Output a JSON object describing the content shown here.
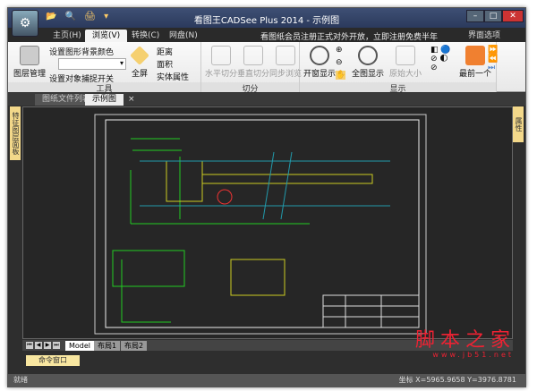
{
  "window": {
    "title": "看图王CADSee Plus 2014 - 示例图",
    "quick_access": "📂 🔍 🖨 ▾",
    "minimize": "–",
    "maximize": "□",
    "close": "✕"
  },
  "ribbon_tabs": [
    {
      "label": "主页(H)"
    },
    {
      "label": "浏览(V)"
    },
    {
      "label": "转换(C)"
    },
    {
      "label": "网盘(N)"
    }
  ],
  "notice": "看图纸会员注册正式对外开放，立即注册免费半年",
  "ui_options": "界面选项",
  "groups": {
    "tools": {
      "label": "工具",
      "layer_manager": "图层管理",
      "set_bg": "设置图形背景颜色",
      "snap": "设置对象捕捉开关",
      "fullscreen": "全屏",
      "distance": "距离",
      "area": "面积",
      "entity_props": "实体属性"
    },
    "split": {
      "label": "切分",
      "horizontal": "水平切分",
      "vertical": "垂直切分",
      "sync": "同步浏览"
    },
    "display": {
      "label": "显示",
      "window_zoom": "开窗显示",
      "full_display": "全图显示",
      "original_size": "原始大小",
      "last_one": "最前一个"
    }
  },
  "doc_tabs": [
    {
      "label": "图纸文件列表"
    },
    {
      "label": "示例图"
    }
  ],
  "left_panel": "特征图层面板",
  "right_panel": "属性",
  "layout_tabs": [
    {
      "label": "Model"
    },
    {
      "label": "布局1"
    },
    {
      "label": "布局2"
    }
  ],
  "command_window": "命令窗口",
  "status": {
    "ready": "就绪",
    "coords": "坐标 X=5965.9658 Y=3976.8781"
  },
  "watermark": {
    "text": "脚本之家",
    "url": "www.jb51.net"
  }
}
